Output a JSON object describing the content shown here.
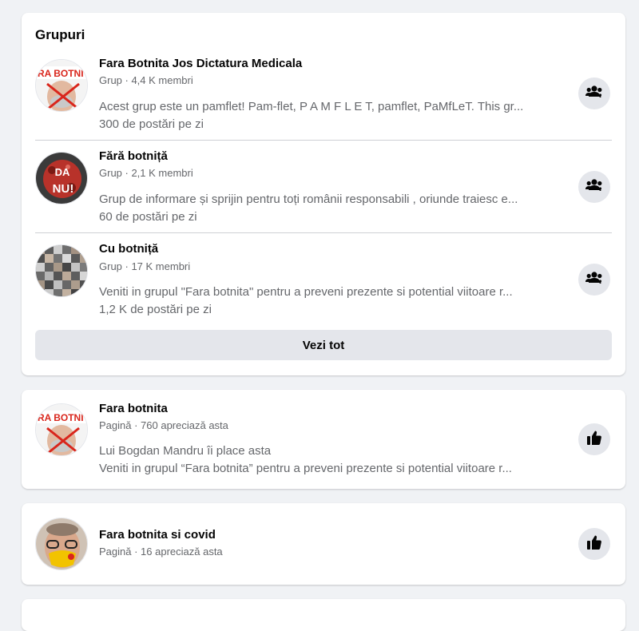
{
  "groups_section": {
    "title": "Grupuri",
    "see_all_label": "Vezi tot",
    "items": [
      {
        "name": "Fara Botnita Jos Dictatura Medicala",
        "meta": "Grup · 4,4 K membri",
        "description": "Acest grup este un pamflet! Pam-flet, P A M F L E T, pamflet, PaMfLeT. This gr...",
        "posts": "300 de postări pe zi",
        "avatar_text": "RA BOTNI",
        "action_icon": "join-group-icon"
      },
      {
        "name": "Fără botniță",
        "meta": "Grup · 2,1 K membri",
        "description": "Grup de informare și sprijin pentru toți românii responsabili , oriunde traiesc e...",
        "posts": "60 de postări pe zi",
        "avatar_text_1": "DA",
        "avatar_text_2": "NU!",
        "action_icon": "join-group-icon"
      },
      {
        "name": "Cu botniță",
        "meta": "Grup · 17 K membri",
        "description": "Veniti in grupul \"Fara botnita\" pentru a preveni prezente si potential viitoare r...",
        "posts": "1,2 K de postări pe zi",
        "action_icon": "join-group-icon"
      }
    ]
  },
  "pages": [
    {
      "name": "Fara botnita",
      "meta": "Pagină · 760 apreciază asta",
      "social": "Lui Bogdan Mandru îi place asta",
      "description": "Veniti in grupul “Fara botnita” pentru a preveni prezente si potential viitoare r...",
      "avatar_text": "RA BOTNI",
      "action_icon": "like-icon"
    },
    {
      "name": "Fara botnita si covid",
      "meta": "Pagină · 16 apreciază asta",
      "action_icon": "like-icon"
    }
  ],
  "colors": {
    "background": "#f0f2f5",
    "card": "#ffffff",
    "secondary_text": "#65676b",
    "button_gray": "#e4e6eb",
    "avatar_red": "#d9261c"
  }
}
